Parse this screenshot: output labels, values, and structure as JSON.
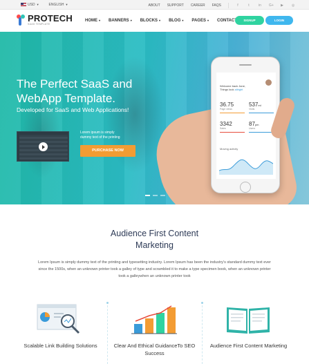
{
  "topbar": {
    "currency": "USD",
    "language": "ENGLISH",
    "links": [
      "ABOUT",
      "SUPPORT",
      "CAREER",
      "FAQS"
    ],
    "social_icons": [
      "facebook-icon",
      "twitter-icon",
      "linkedin-icon",
      "google-plus-icon",
      "youtube-icon",
      "instagram-icon"
    ]
  },
  "header": {
    "logo_text": "PROTECH",
    "logo_sub": "SAAS TEMPLATE",
    "nav": [
      "HOME",
      "BANNERS",
      "BLOCKS",
      "BLOG",
      "PAGES",
      "CONTACT"
    ],
    "signup_label": "SIGNUP",
    "login_label": "LOGIN"
  },
  "hero": {
    "title": "The Perfect SaaS and WebApp Template.",
    "subtitle": "Developed for SaaS and Web Applications!",
    "blurb": "Lorem ipsum is simply dummy text of the printing",
    "purchase_label": "PURCHASE NOW",
    "phone": {
      "welcome_line1": "Welcome back Jane,",
      "welcome_line2": "Things look ",
      "welcome_highlight": "allright",
      "stats": [
        {
          "value": "36.75",
          "unit": "",
          "label": "Page views",
          "color": "#f39c33"
        },
        {
          "value": "537",
          "unit": "ml",
          "label": "Visits",
          "color": "#3a9bd9"
        },
        {
          "value": "3342",
          "unit": "",
          "label": "Sales",
          "color": "#e74c3c"
        },
        {
          "value": "87",
          "unit": "pm",
          "label": "Users",
          "color": "#3a9bd9"
        }
      ],
      "moving_label": "Moving activity"
    }
  },
  "content": {
    "title_line1": "Audience First Content",
    "title_line2": "Marketing",
    "text": "Lorem Ipsum is simply dummy text of the printing and typesetting industry. Lorem Ipsum has been the industry's standard dummy text ever since the 1500s, when an unknown printer took a galley of type and scrambled it to make a type specimen book, when an unknown printer took a galleywhen an unknown printer took"
  },
  "features": [
    {
      "title": "Scalable Link Building Solutions",
      "icon": "analytics-magnifier-icon"
    },
    {
      "title": "Clear And Ethical GuidanceTo SEO Success",
      "icon": "bar-chart-icon"
    },
    {
      "title": "Audience First Content Marketing",
      "icon": "open-book-icon"
    }
  ],
  "colors": {
    "hero_start": "#1fb9a6",
    "hero_end": "#7ec3d8",
    "signup": "#2fd3a0",
    "login": "#3fb7ee",
    "purchase": "#f39c33",
    "heading": "#2d3a56"
  }
}
